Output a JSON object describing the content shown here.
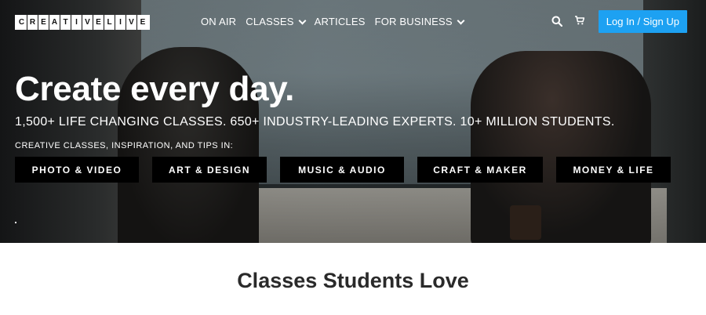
{
  "logo": {
    "letters": [
      "C",
      "R",
      "E",
      "A",
      "T",
      "I",
      "V",
      "E",
      "L",
      "I",
      "V",
      "E"
    ]
  },
  "nav": {
    "items": [
      {
        "label": "ON AIR",
        "dropdown": false
      },
      {
        "label": "CLASSES",
        "dropdown": true
      },
      {
        "label": "ARTICLES",
        "dropdown": false
      },
      {
        "label": "FOR BUSINESS",
        "dropdown": true
      }
    ],
    "icons": [
      "search-icon",
      "cart-icon"
    ],
    "login_label": "Log In / Sign Up",
    "login_color": "#1da1f2"
  },
  "hero": {
    "title": "Create every day.",
    "subtitle": "1,500+ LIFE CHANGING CLASSES. 650+ INDUSTRY-LEADING EXPERTS. 10+ MILLION STUDENTS.",
    "tips": "CREATIVE CLASSES, INSPIRATION, AND TIPS IN:",
    "categories": [
      "PHOTO & VIDEO",
      "ART & DESIGN",
      "MUSIC & AUDIO",
      "CRAFT & MAKER",
      "MONEY & LIFE"
    ]
  },
  "section": {
    "title": "Classes Students Love"
  }
}
